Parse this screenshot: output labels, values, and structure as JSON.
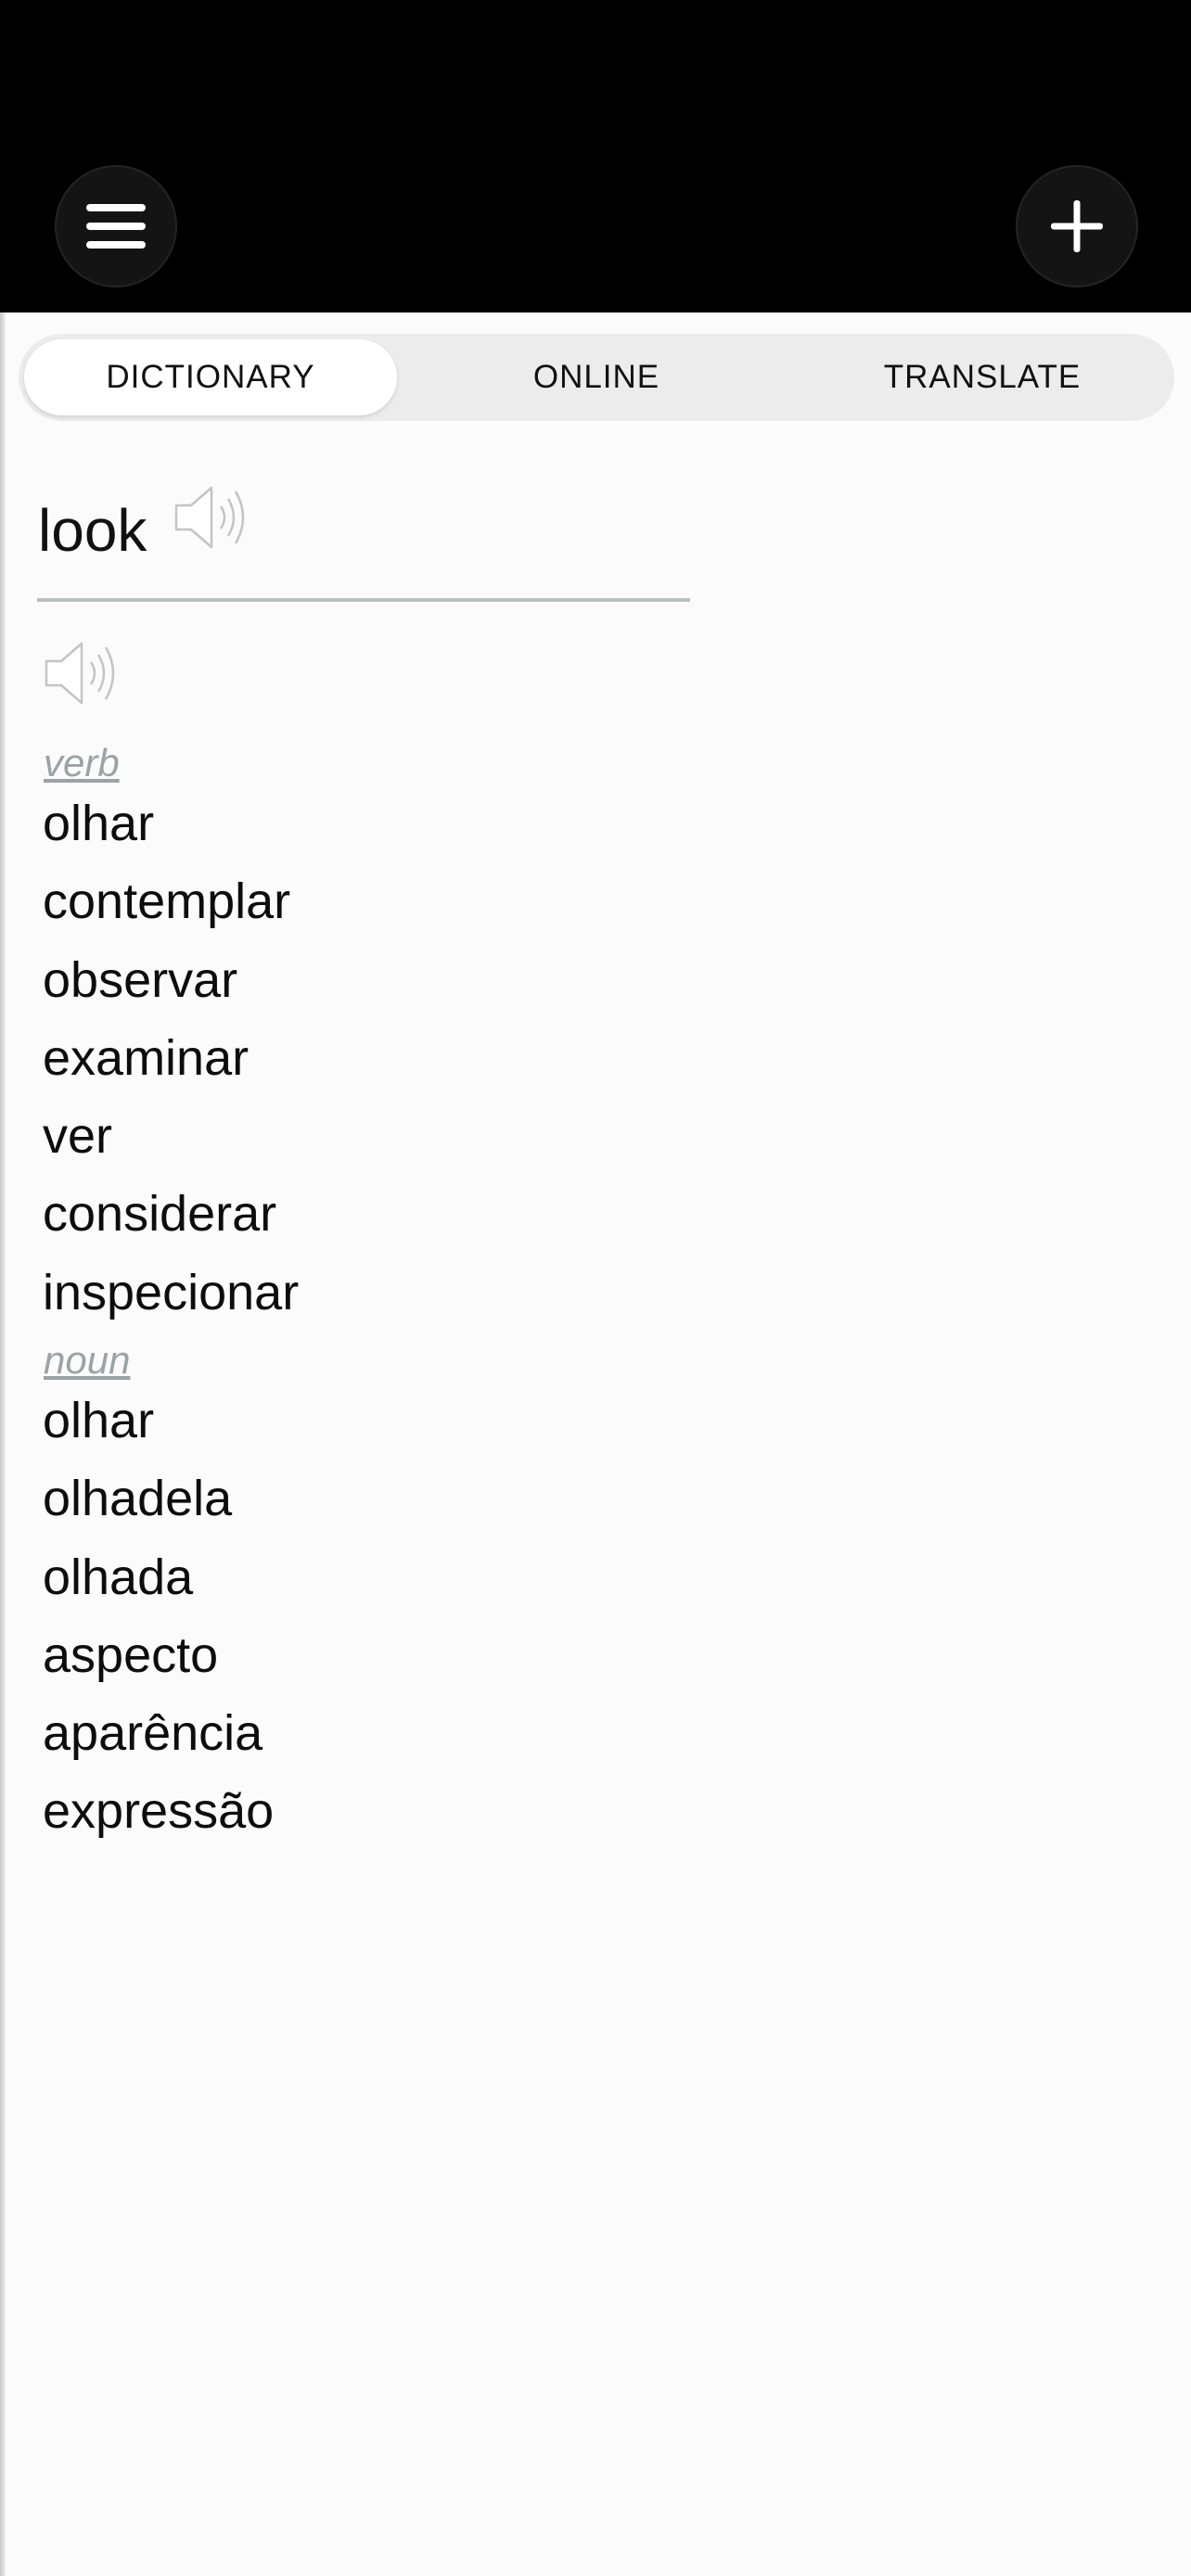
{
  "top_bar": {
    "menu_icon": "hamburger-menu-icon",
    "add_icon": "plus-icon"
  },
  "tabs": [
    {
      "label": "DICTIONARY",
      "active": true
    },
    {
      "label": "ONLINE",
      "active": false
    },
    {
      "label": "TRANSLATE",
      "active": false
    }
  ],
  "entry": {
    "headword": "look",
    "speaker_icon": "speaker-icon",
    "senses": [
      {
        "part_of_speech": "verb",
        "translations": [
          "olhar",
          "contemplar",
          "observar",
          "examinar",
          "ver",
          "considerar",
          "inspecionar"
        ]
      },
      {
        "part_of_speech": "noun",
        "translations": [
          "olhar",
          "olhadela",
          "olhada",
          "aspecto",
          "aparência",
          "expressão"
        ]
      }
    ]
  },
  "colors": {
    "top_bar": "#000000",
    "background": "#fbfbfb",
    "segment_track": "#ececec",
    "part_of_speech": "#9aa3a6",
    "divider": "#b9c0c2"
  }
}
